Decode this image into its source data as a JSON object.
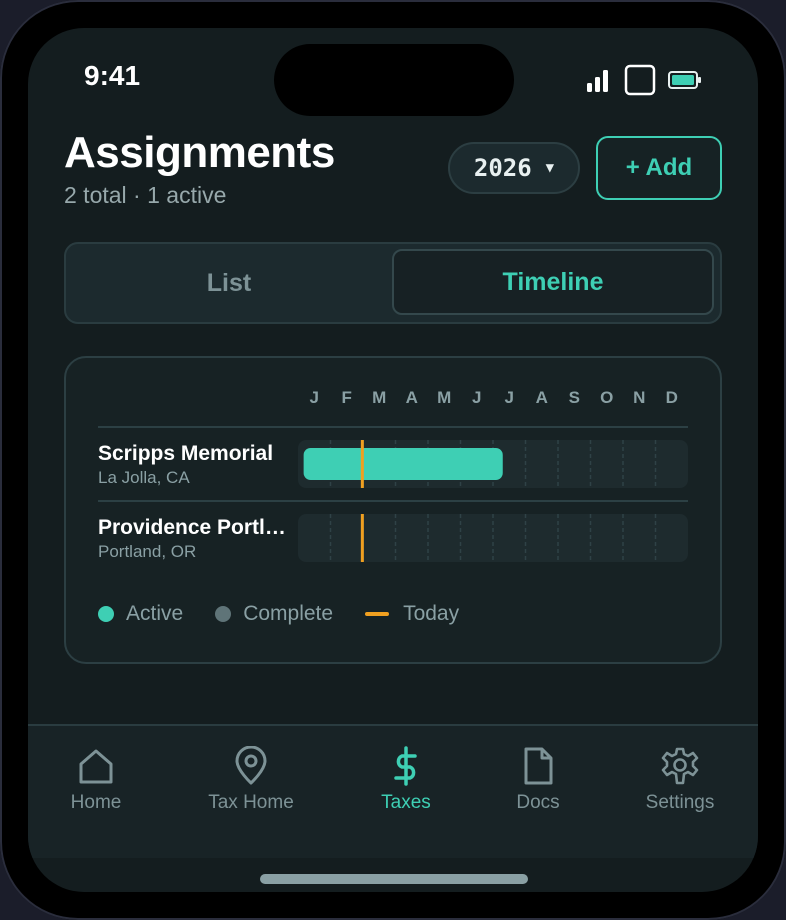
{
  "status_bar": {
    "time": "9:41"
  },
  "header": {
    "title": "Assignments",
    "subtitle": "2 total · 1 active",
    "year": "2026",
    "add_label": "+ Add"
  },
  "view_toggle": {
    "list_label": "List",
    "timeline_label": "Timeline",
    "selected": "Timeline"
  },
  "timeline": {
    "months": [
      "J",
      "F",
      "M",
      "A",
      "M",
      "J",
      "J",
      "A",
      "S",
      "O",
      "N",
      "D"
    ],
    "today_month_fraction": 0.165,
    "assignments": [
      {
        "name": "Scripps Memorial",
        "location": "La Jolla, CA",
        "status": "Active",
        "start_month": 0.05,
        "end_month": 6.3
      },
      {
        "name": "Providence Portland",
        "location": "Portland, OR",
        "status": "Complete",
        "start_month": null,
        "end_month": null
      }
    ],
    "legend": {
      "active": "Active",
      "complete": "Complete",
      "today": "Today"
    }
  },
  "tabs": [
    {
      "label": "Home",
      "icon": "house-icon"
    },
    {
      "label": "Tax Home",
      "icon": "map-pin-icon"
    },
    {
      "label": "Taxes",
      "icon": "dollar-icon"
    },
    {
      "label": "Docs",
      "icon": "document-icon"
    },
    {
      "label": "Settings",
      "icon": "gear-icon"
    }
  ],
  "active_tab": "Taxes",
  "colors": {
    "accent": "#3ecfb4",
    "today": "#f0a020",
    "complete": "#5f7478",
    "background": "#141d1f"
  }
}
